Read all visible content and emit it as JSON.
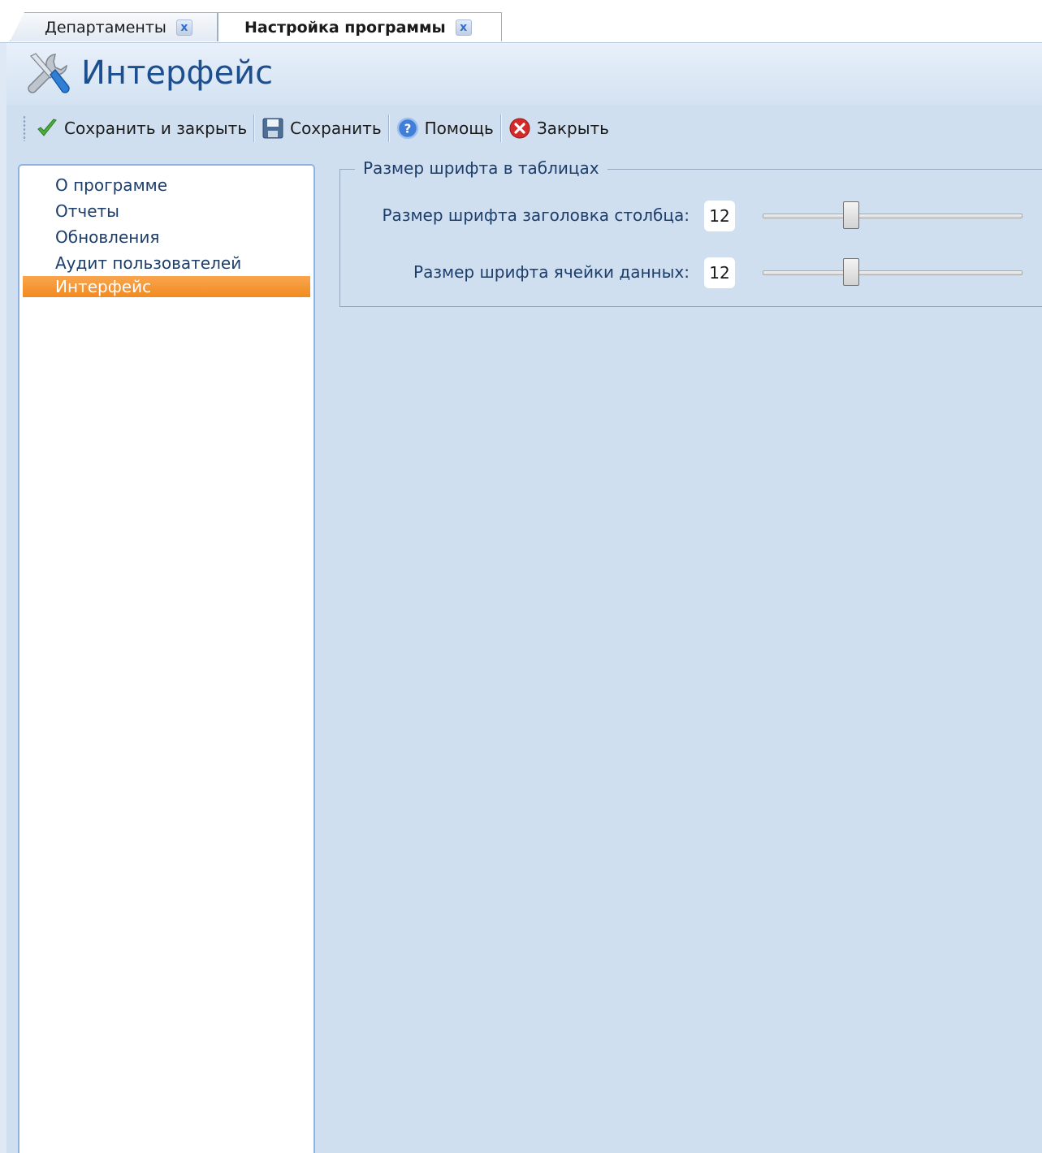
{
  "tabs": [
    {
      "label": "Департаменты",
      "close": "x",
      "active": false
    },
    {
      "label": "Настройка программы",
      "close": "x",
      "active": true
    }
  ],
  "header": {
    "title": "Интерфейс",
    "icon": "tools-icon"
  },
  "toolbar": {
    "save_close_label": "Сохранить и закрыть",
    "save_label": "Сохранить",
    "help_label": "Помощь",
    "close_label": "Закрыть"
  },
  "nav": {
    "items": [
      {
        "label": "О программе"
      },
      {
        "label": "Отчеты"
      },
      {
        "label": "Обновления"
      },
      {
        "label": "Аудит пользователей"
      },
      {
        "label": "Интерфейс"
      }
    ],
    "selected_index": 4
  },
  "font_settings": {
    "legend": "Размер шрифта в таблицах",
    "header_font": {
      "label": "Размер шрифта заголовка столбца:",
      "value": "12",
      "level": 0.33
    },
    "cell_font": {
      "label": "Размер шрифта ячейки данных:",
      "value": "12",
      "level": 0.33
    }
  },
  "colors": {
    "selection": "#f28a1f",
    "title": "#1d4f8f",
    "background": "#cfdff0"
  }
}
